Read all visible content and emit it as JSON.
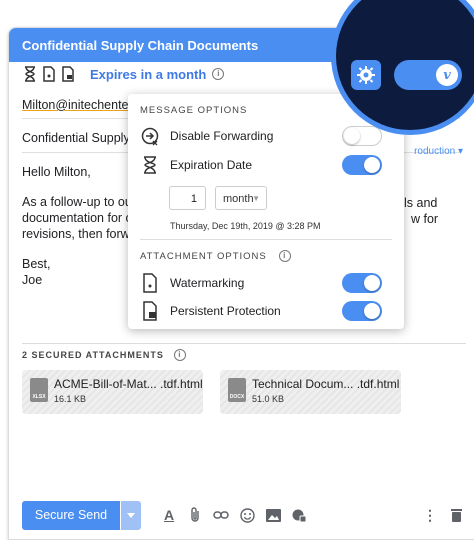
{
  "compose": {
    "title": "Confidential Supply Chain Documents",
    "expiry_label": "Expires in a month",
    "to": "Milton@initechenterp",
    "subject": "Confidential Supply C",
    "intro_link": "roduction ▾",
    "body": {
      "greeting": "Hello Milton,",
      "line1": "As a follow-up to our",
      "line2": "documentation for ou",
      "line3": "revisions, then forwa",
      "frag1": "ls and",
      "frag2": "w for",
      "closing": "Best,",
      "signature": "Joe"
    }
  },
  "attachments": {
    "header": "2 SECURED ATTACHMENTS",
    "items": [
      {
        "name": "ACME-Bill-of-Mat... .tdf.html",
        "size": "16.1 KB",
        "type": "XLSX"
      },
      {
        "name": "Technical Docum... .tdf.html",
        "size": "51.0 KB",
        "type": "DOCX"
      }
    ]
  },
  "toolbar": {
    "send_label": "Secure Send"
  },
  "popup": {
    "message_options_title": "MESSAGE OPTIONS",
    "disable_forwarding": {
      "label": "Disable Forwarding",
      "on": false
    },
    "expiration_date": {
      "label": "Expiration Date",
      "on": true
    },
    "expiry_amount": "1",
    "expiry_unit": "month",
    "expiry_full": "Thursday, Dec 19th, 2019 @ 3:28 PM",
    "attachment_options_title": "ATTACHMENT OPTIONS",
    "watermarking": {
      "label": "Watermarking",
      "on": true
    },
    "persistent_protection": {
      "label": "Persistent Protection",
      "on": true
    }
  },
  "colors": {
    "accent": "#4a8ef2",
    "dark_navy": "#0d1b3e"
  }
}
